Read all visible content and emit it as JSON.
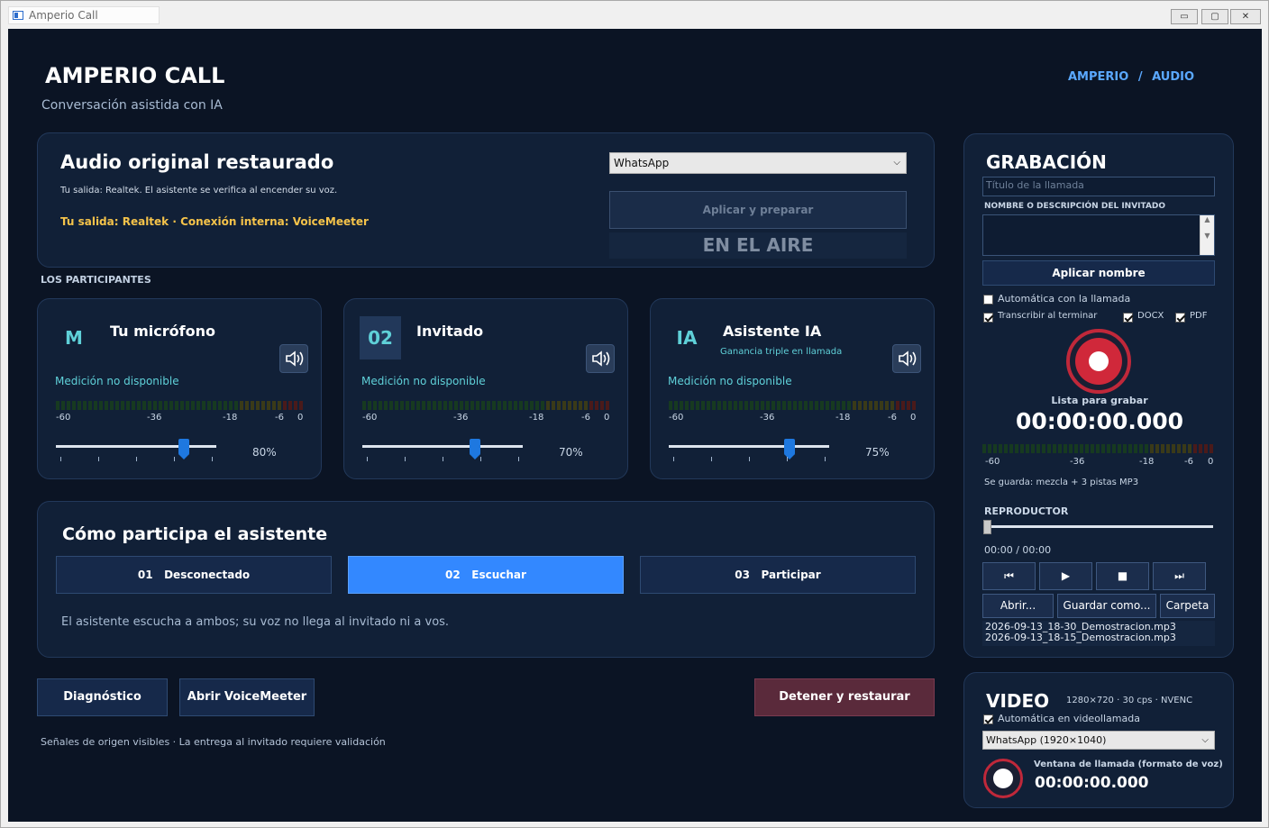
{
  "window": {
    "title": "Amperio Call",
    "min_glyph": "▭",
    "max_glyph": "▢",
    "close_glyph": "✕"
  },
  "header": {
    "app_title": "AMPERIO CALL",
    "subtitle": "Conversación asistida con IA",
    "breadcrumb": [
      "AMPERIO",
      "/",
      "AUDIO"
    ]
  },
  "status_card": {
    "title": "Audio original restaurado",
    "detail": "Tu salida: Realtek. El asistente se verifica al encender su voz.",
    "routing": "Tu salida: Realtek · Conexión interna: VoiceMeeter",
    "app_select": "WhatsApp",
    "apply_button": "Aplicar y preparar",
    "on_air": "EN EL AIRE"
  },
  "participants_label": "LOS PARTICIPANTES",
  "participants": [
    {
      "badge": "M",
      "name": "Tu micrófono",
      "sub": "",
      "meter_status": "Medición no disponible",
      "volume": 80,
      "volume_label": "80%"
    },
    {
      "badge": "02",
      "name": "Invitado",
      "sub": "",
      "meter_status": "Medición no disponible",
      "volume": 70,
      "volume_label": "70%"
    },
    {
      "badge": "IA",
      "name": "Asistente IA",
      "sub": "Ganancia triple en llamada",
      "meter_status": "Medición no disponible",
      "volume": 75,
      "volume_label": "75%"
    }
  ],
  "meter_ticks": [
    "-60",
    "-36",
    "-18",
    "-6",
    "0"
  ],
  "mode_card": {
    "title": "Cómo participa el asistente",
    "modes": [
      {
        "num": "01",
        "label": "Desconectado",
        "active": false
      },
      {
        "num": "02",
        "label": "Escuchar",
        "active": true
      },
      {
        "num": "03",
        "label": "Participar",
        "active": false
      }
    ],
    "description": "El asistente escucha a ambos; su voz no llega al invitado ni a vos."
  },
  "footer": {
    "diagnostics": "Diagnóstico",
    "open_voicemeeter": "Abrir VoiceMeeter",
    "stop_restore": "Detener y restaurar",
    "note": "Señales de origen visibles · La entrega al invitado requiere validación"
  },
  "recording": {
    "title": "GRABACIÓN",
    "call_title_placeholder": "Título de la llamada",
    "guest_label": "NOMBRE O DESCRIPCIÓN DEL INVITADO",
    "apply_name": "Aplicar nombre",
    "auto_with_call": "Automática con la llamada",
    "transcribe": "Transcribir al terminar",
    "docx": "DOCX",
    "pdf": "PDF",
    "status": "Lista para grabar",
    "timer": "00:00:00.000",
    "saves": "Se guarda: mezcla + 3 pistas MP3",
    "player_label": "REPRODUCTOR",
    "player_time": "00:00 / 00:00",
    "open": "Abrir...",
    "save_as": "Guardar como...",
    "folder": "Carpeta",
    "files": [
      "2026-09-13_18-30_Demostracion.mp3",
      "2026-09-13_18-15_Demostracion.mp3"
    ],
    "auto_checked": false,
    "transcribe_checked": true,
    "docx_checked": true,
    "pdf_checked": true
  },
  "video": {
    "title": "VIDEO",
    "specs": "1280×720 · 30 cps · NVENC",
    "auto_video": "Automática en videollamada",
    "source": "WhatsApp  (1920×1040)",
    "window_label": "Ventana de llamada (formato de voz)",
    "timer": "00:00:00.000",
    "auto_checked": true
  },
  "colors": {
    "background": "#0b1424",
    "card": "#112037",
    "accent": "#3388ff",
    "routing": "#f5c34a",
    "danger": "#5a2a3b",
    "record": "#d0283a"
  }
}
